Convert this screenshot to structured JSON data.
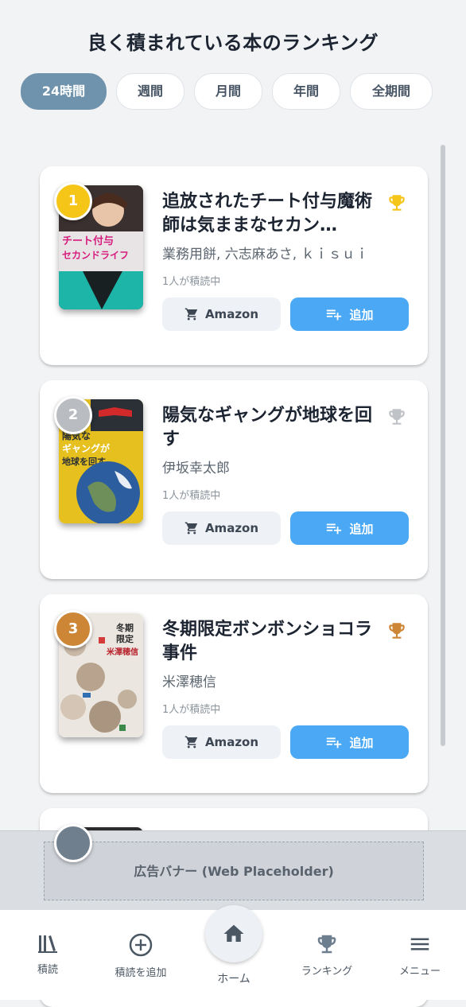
{
  "page_title": "良く積まれている本のランキング",
  "tabs": [
    {
      "label": "24時間",
      "active": true
    },
    {
      "label": "週間",
      "active": false
    },
    {
      "label": "月間",
      "active": false
    },
    {
      "label": "年間",
      "active": false
    },
    {
      "label": "全期間",
      "active": false
    }
  ],
  "books": [
    {
      "rank": "1",
      "title": "追放されたチート付与魔術師は気ままなセカン…",
      "author": "業務用餅, 六志麻あさ, ｋｉｓｕｉ",
      "readers": "1人が積読中",
      "rank_color": "#f5c518",
      "trophy_color": "#f5c518"
    },
    {
      "rank": "2",
      "title": "陽気なギャングが地球を回す",
      "author": "伊坂幸太郎",
      "readers": "1人が積読中",
      "rank_color": "#b9bcc0",
      "trophy_color": "#bfc2c6"
    },
    {
      "rank": "3",
      "title": "冬期限定ボンボンショコラ事件",
      "author": "米澤穂信",
      "readers": "1人が積読中",
      "rank_color": "#cd8636",
      "trophy_color": "#cd8636"
    }
  ],
  "buttons": {
    "amazon": "Amazon",
    "add": "追加"
  },
  "ad": {
    "label": "広告バナー (Web Placeholder)"
  },
  "nav": {
    "tsundoku": "積読",
    "add_tsundoku": "積読を追加",
    "home": "ホーム",
    "ranking": "ランキング",
    "menu": "メニュー"
  },
  "colors": {
    "accent": "#4aa8f5",
    "tab_active": "#7093ad",
    "gold": "#f5c518",
    "silver": "#b9bcc0",
    "bronze": "#cd8636"
  },
  "icons": [
    "cart-icon",
    "playlist-add-icon",
    "trophy-icon",
    "library-icon",
    "plus-circle-icon",
    "home-icon",
    "menu-icon"
  ]
}
